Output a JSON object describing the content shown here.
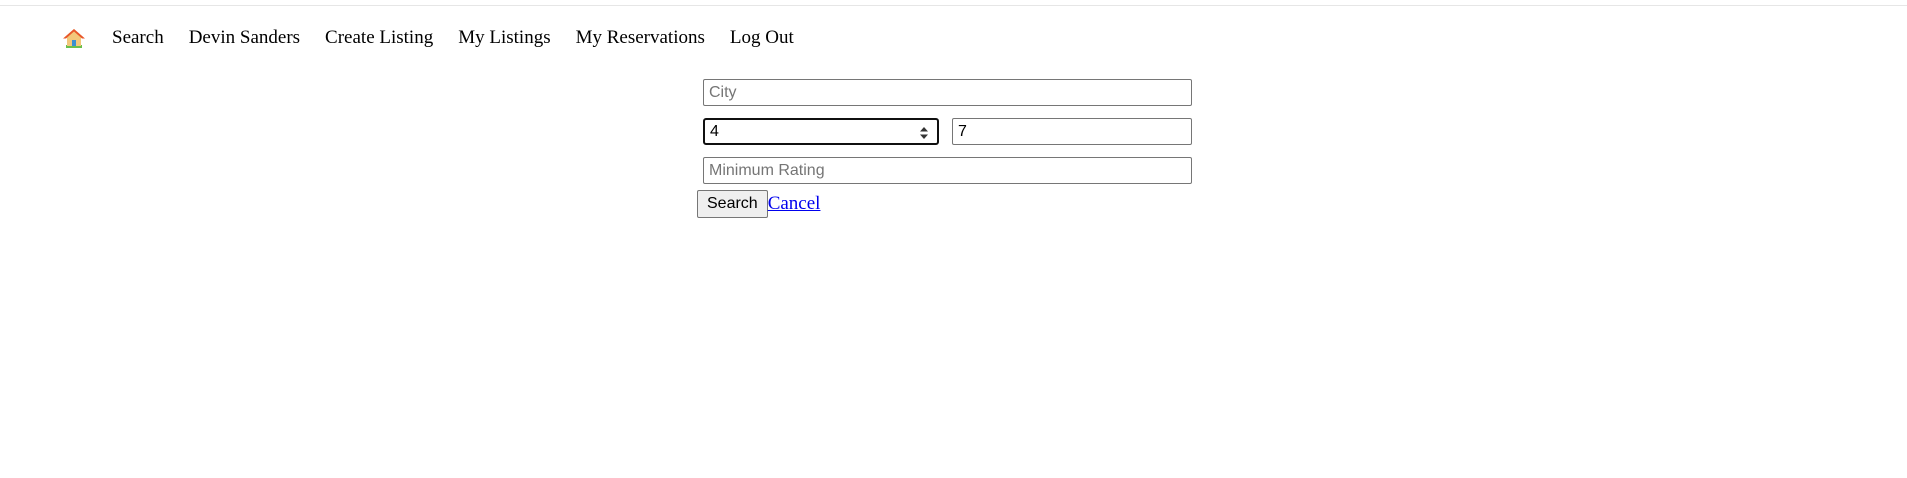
{
  "nav": {
    "home_icon": "house-icon",
    "items": [
      {
        "label": "Search"
      },
      {
        "label": "Devin Sanders"
      },
      {
        "label": "Create Listing"
      },
      {
        "label": "My Listings"
      },
      {
        "label": "My Reservations"
      },
      {
        "label": "Log Out"
      }
    ]
  },
  "form": {
    "city": {
      "placeholder": "City",
      "value": ""
    },
    "guests_min": {
      "value": "4"
    },
    "guests_max": {
      "value": "7"
    },
    "min_rating": {
      "placeholder": "Minimum Rating",
      "value": ""
    },
    "search_label": "Search",
    "cancel_label": "Cancel"
  },
  "colors": {
    "link": "#0000ee",
    "house_roof": "#e8572a",
    "house_wall": "#f3c77b",
    "house_door": "#3a8fd1",
    "house_ground": "#6abf4b"
  }
}
